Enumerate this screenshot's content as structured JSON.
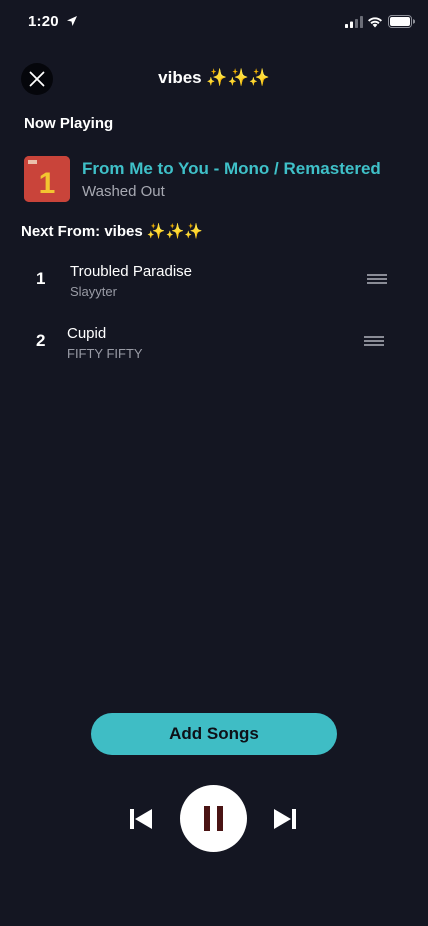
{
  "status_bar": {
    "time": "1:20"
  },
  "header": {
    "title": "vibes ✨✨✨"
  },
  "now_playing": {
    "label": "Now Playing",
    "album_art_text": "1",
    "title": "From Me to You - Mono / Remastered",
    "artist": "Washed Out"
  },
  "next_from": {
    "label": "Next From: vibes ✨✨✨"
  },
  "queue": [
    {
      "index": "1",
      "title": "Troubled Paradise",
      "artist": "Slayyter"
    },
    {
      "index": "2",
      "title": "Cupid",
      "artist": "FIFTY FIFTY"
    }
  ],
  "add_songs": {
    "label": "Add Songs"
  },
  "colors": {
    "background": "#141622",
    "accent": "#3fbdc5",
    "pause_icon": "#4a1414"
  },
  "icons": {
    "close": "close-icon",
    "previous": "skip-previous-icon",
    "pause": "pause-icon",
    "next": "skip-next-icon",
    "drag": "drag-handle-icon"
  }
}
